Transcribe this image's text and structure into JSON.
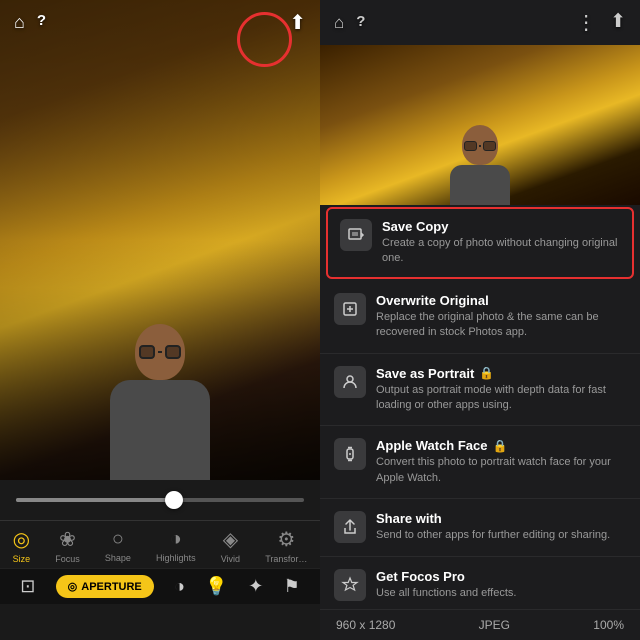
{
  "left": {
    "home_icon": "⌂",
    "help_icon": "?",
    "share_icon": "⬆",
    "tabs": [
      {
        "id": "size",
        "label": "Size",
        "icon": "◎",
        "active": true
      },
      {
        "id": "focus",
        "label": "Focus",
        "icon": "❀",
        "active": false
      },
      {
        "id": "shape",
        "label": "Shape",
        "icon": "○",
        "active": false
      },
      {
        "id": "highlights",
        "label": "Highlights",
        "icon": "◑",
        "active": false
      },
      {
        "id": "vivid",
        "label": "Vivid",
        "icon": "◈",
        "active": false
      },
      {
        "id": "transform",
        "label": "Transfor…",
        "icon": "⚙",
        "active": false
      }
    ],
    "toolbar": {
      "crop_icon": "⊡",
      "aperture_label": "APERTURE",
      "aperture_icon": "◎",
      "tone_icon": "◑",
      "light_icon": "💡",
      "magic_icon": "✦",
      "flag_icon": "⚑"
    }
  },
  "right": {
    "home_icon": "⌂",
    "help_icon": "?",
    "more_icon": "⋮",
    "share_icon": "⬆",
    "menu_items": [
      {
        "id": "save-copy",
        "title": "Save Copy",
        "desc": "Create a copy of photo without changing original one.",
        "icon": "🖼",
        "highlighted": true,
        "locked": false
      },
      {
        "id": "overwrite-original",
        "title": "Overwrite Original",
        "desc": "Replace the original photo & the same can be recovered in stock Photos app.",
        "icon": "💾",
        "highlighted": false,
        "locked": false
      },
      {
        "id": "save-as-portrait",
        "title": "Save as Portrait",
        "desc": "Output as portrait mode with depth data for fast loading or other apps using.",
        "icon": "👤",
        "highlighted": false,
        "locked": true
      },
      {
        "id": "apple-watch-face",
        "title": "Apple Watch Face",
        "desc": "Convert this photo to portrait watch face for your Apple Watch.",
        "icon": "⌚",
        "highlighted": false,
        "locked": true
      },
      {
        "id": "share-with",
        "title": "Share with",
        "desc": "Send to other apps for further editing or sharing.",
        "icon": "↗",
        "highlighted": false,
        "locked": false
      },
      {
        "id": "get-focos-pro",
        "title": "Get Focos Pro",
        "desc": "Use all functions and effects.",
        "icon": "♛",
        "highlighted": false,
        "locked": false
      }
    ],
    "footer": {
      "dimensions": "960 x 1280",
      "format": "JPEG",
      "zoom": "100%"
    }
  }
}
